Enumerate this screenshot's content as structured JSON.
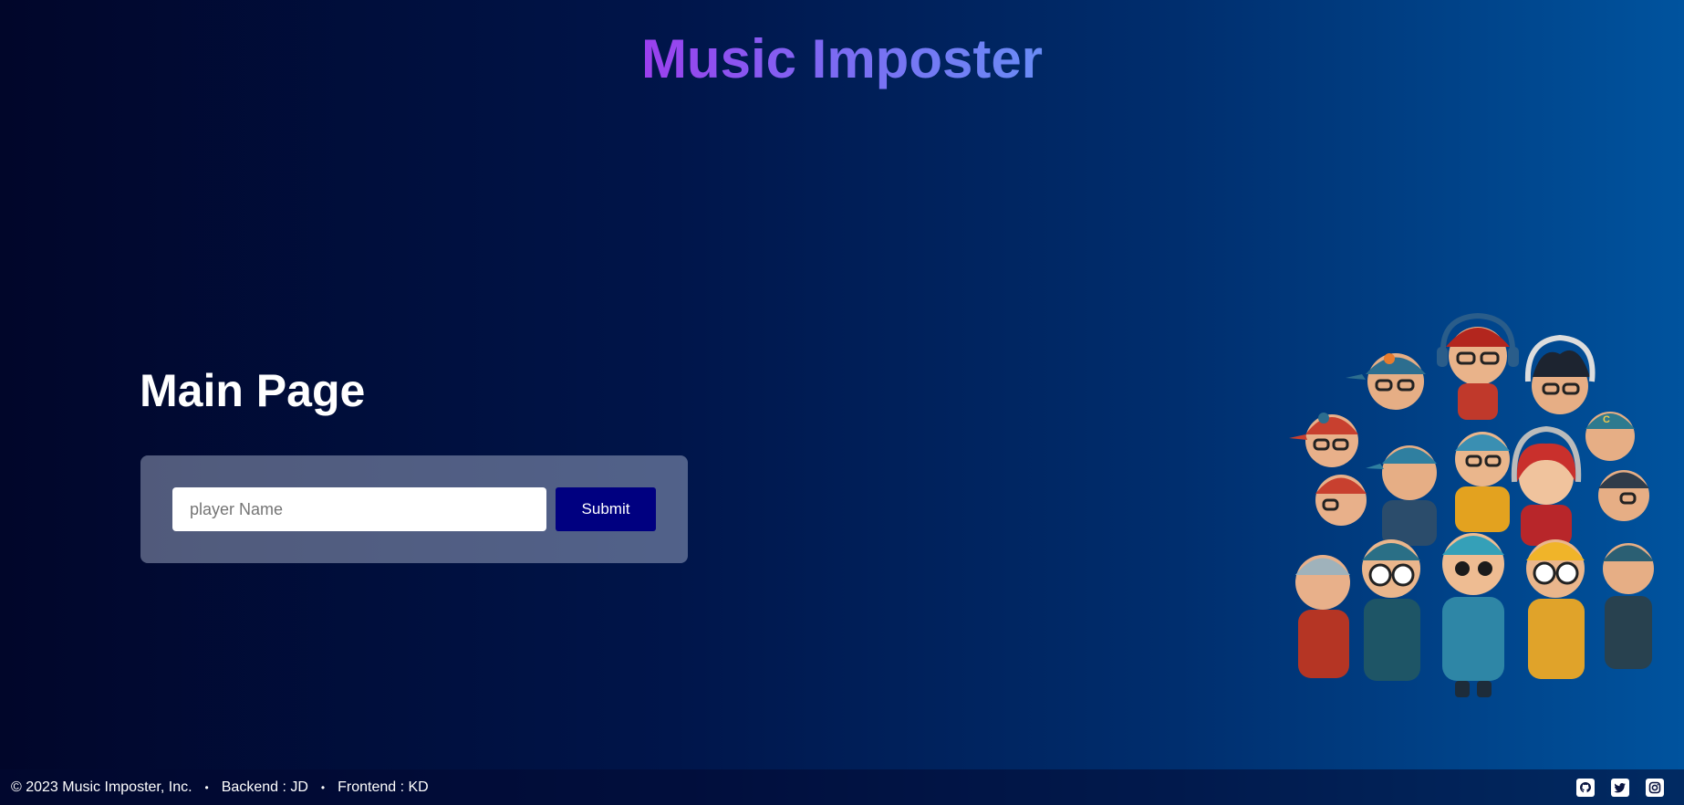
{
  "header": {
    "title": "Music Imposter"
  },
  "main": {
    "heading": "Main Page",
    "form": {
      "input_placeholder": "player Name",
      "input_value": "",
      "submit_label": "Submit"
    }
  },
  "footer": {
    "copyright": "© 2023 Music Imposter, Inc.",
    "separator": "•",
    "backend": "Backend : JD",
    "frontend": "Frontend : KD",
    "social_icons": [
      "github-icon",
      "twitter-icon",
      "instagram-icon"
    ]
  },
  "colors": {
    "title_gradient_start": "#9b3fee",
    "title_gradient_end": "#6a8cf6",
    "submit_button": "#000080",
    "background_left": "#01062a",
    "background_right": "#00539e"
  }
}
